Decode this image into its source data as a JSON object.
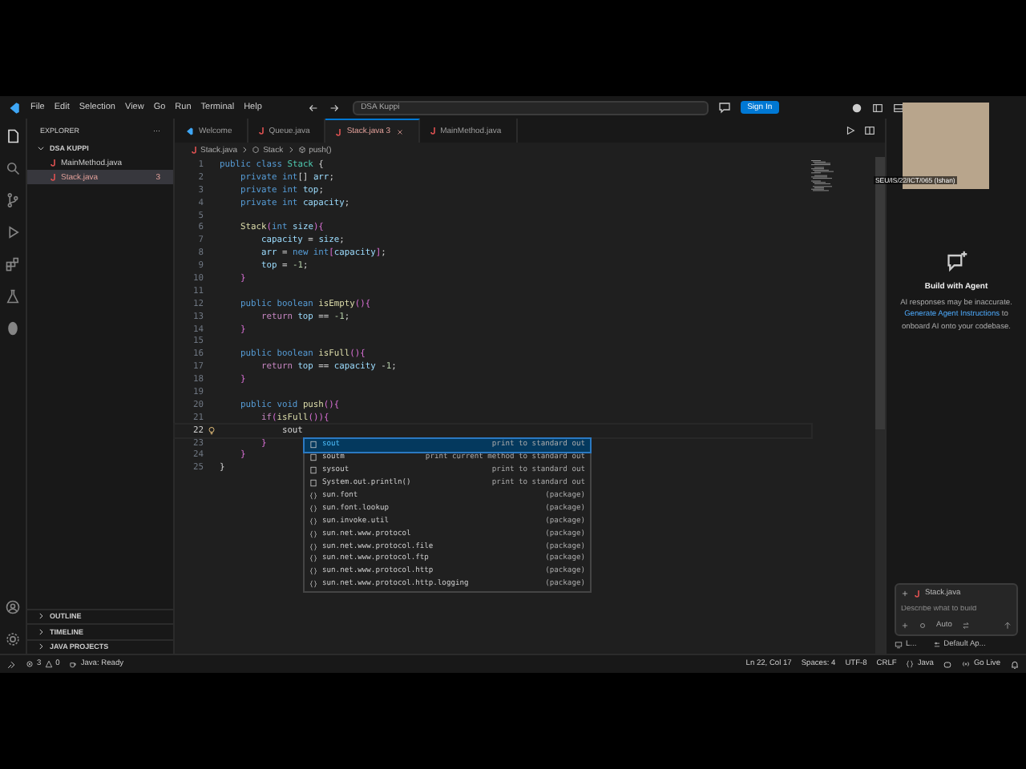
{
  "title_bar": {
    "menu": [
      "File",
      "Edit",
      "Selection",
      "View",
      "Go",
      "Run",
      "Terminal",
      "Help"
    ],
    "search": "DSA Kuppi",
    "sign_in": "Sign In"
  },
  "webcam": {
    "label": "SEU/IS/22/ICT/065 (Ishan)"
  },
  "sidebar": {
    "title": "EXPLORER",
    "more": "···",
    "folder": {
      "name": "DSA KUPPI",
      "expanded": true,
      "files": [
        {
          "name": "MainMethod.java",
          "selected": false
        },
        {
          "name": "Stack.java",
          "badge": "3",
          "selected": true
        }
      ]
    },
    "sections": [
      "OUTLINE",
      "TIMELINE",
      "JAVA PROJECTS"
    ]
  },
  "tabs": [
    {
      "label": "Welcome",
      "kind": "welcome",
      "selected": false
    },
    {
      "label": "Queue.java",
      "kind": "java",
      "selected": false
    },
    {
      "label": "Stack.java",
      "kind": "java",
      "badge": "3",
      "selected": true
    },
    {
      "label": "MainMethod.java",
      "kind": "java",
      "selected": false
    }
  ],
  "breadcrumb": [
    {
      "label": "Stack.java",
      "kind": "file"
    },
    {
      "label": "Stack",
      "kind": "class"
    },
    {
      "label": "push()",
      "kind": "method"
    }
  ],
  "code": [
    {
      "n": "1",
      "current": false,
      "tokens": [
        {
          "text": "public class ",
          "kind": "keyword"
        },
        {
          "text": "Stack",
          "kind": "type"
        },
        {
          "text": " {",
          "kind": "plain"
        }
      ]
    },
    {
      "n": "2",
      "current": false,
      "tokens": [
        {
          "text": "    private int",
          "kind": "keyword"
        },
        {
          "text": "[] ",
          "kind": "plain"
        },
        {
          "text": "arr",
          "kind": "variable"
        },
        {
          "text": ";",
          "kind": "plain"
        }
      ]
    },
    {
      "n": "3",
      "current": false,
      "tokens": [
        {
          "text": "    private int ",
          "kind": "keyword"
        },
        {
          "text": "top",
          "kind": "variable"
        },
        {
          "text": ";",
          "kind": "plain"
        }
      ]
    },
    {
      "n": "4",
      "current": false,
      "tokens": [
        {
          "text": "    private int ",
          "kind": "keyword"
        },
        {
          "text": "capacity",
          "kind": "variable"
        },
        {
          "text": ";",
          "kind": "plain"
        }
      ]
    },
    {
      "n": "5",
      "current": false
    },
    {
      "n": "6",
      "current": false,
      "tokens": [
        {
          "text": "    Stack",
          "kind": "function"
        },
        {
          "text": "(",
          "kind": "bracket"
        },
        {
          "text": "int ",
          "kind": "keyword"
        },
        {
          "text": "size",
          "kind": "variable"
        },
        {
          "text": "){",
          "kind": "bracket"
        }
      ]
    },
    {
      "n": "7",
      "current": false,
      "tokens": [
        {
          "text": "        capacity",
          "kind": "variable"
        },
        {
          "text": " = ",
          "kind": "plain"
        },
        {
          "text": "size",
          "kind": "variable"
        },
        {
          "text": ";",
          "kind": "plain"
        }
      ]
    },
    {
      "n": "8",
      "current": false,
      "tokens": [
        {
          "text": "        arr",
          "kind": "variable"
        },
        {
          "text": " = ",
          "kind": "plain"
        },
        {
          "text": "new int",
          "kind": "keyword"
        },
        {
          "text": "[",
          "kind": "bracket"
        },
        {
          "text": "capacity",
          "kind": "variable"
        },
        {
          "text": "]",
          "kind": "bracket"
        },
        {
          "text": ";",
          "kind": "plain"
        }
      ]
    },
    {
      "n": "9",
      "current": false,
      "tokens": [
        {
          "text": "        top",
          "kind": "variable"
        },
        {
          "text": " = ",
          "kind": "plain"
        },
        {
          "text": "-1",
          "kind": "number"
        },
        {
          "text": ";",
          "kind": "plain"
        }
      ]
    },
    {
      "n": "10",
      "current": false,
      "tokens": [
        {
          "text": "    }",
          "kind": "bracket"
        }
      ]
    },
    {
      "n": "11",
      "current": false
    },
    {
      "n": "12",
      "current": false,
      "tokens": [
        {
          "text": "    public boolean ",
          "kind": "keyword"
        },
        {
          "text": "isEmpty",
          "kind": "function"
        },
        {
          "text": "(){",
          "kind": "bracket"
        }
      ]
    },
    {
      "n": "13",
      "current": false,
      "tokens": [
        {
          "text": "        return ",
          "kind": "control"
        },
        {
          "text": "top",
          "kind": "variable"
        },
        {
          "text": " == ",
          "kind": "plain"
        },
        {
          "text": "-1",
          "kind": "number"
        },
        {
          "text": ";",
          "kind": "plain"
        }
      ]
    },
    {
      "n": "14",
      "current": false,
      "tokens": [
        {
          "text": "    }",
          "kind": "bracket"
        }
      ]
    },
    {
      "n": "15",
      "current": false
    },
    {
      "n": "16",
      "current": false,
      "tokens": [
        {
          "text": "    public boolean ",
          "kind": "keyword"
        },
        {
          "text": "isFull",
          "kind": "function"
        },
        {
          "text": "(){",
          "kind": "bracket"
        }
      ]
    },
    {
      "n": "17",
      "current": false,
      "tokens": [
        {
          "text": "        return ",
          "kind": "control"
        },
        {
          "text": "top",
          "kind": "variable"
        },
        {
          "text": " == ",
          "kind": "plain"
        },
        {
          "text": "capacity",
          "kind": "variable"
        },
        {
          "text": " -",
          "kind": "plain"
        },
        {
          "text": "1",
          "kind": "number"
        },
        {
          "text": ";",
          "kind": "plain"
        }
      ]
    },
    {
      "n": "18",
      "current": false,
      "tokens": [
        {
          "text": "    }",
          "kind": "bracket"
        }
      ]
    },
    {
      "n": "19",
      "current": false
    },
    {
      "n": "20",
      "current": false,
      "tokens": [
        {
          "text": "    public void ",
          "kind": "keyword"
        },
        {
          "text": "push",
          "kind": "function"
        },
        {
          "text": "(){",
          "kind": "bracket"
        }
      ]
    },
    {
      "n": "21",
      "current": false,
      "tokens": [
        {
          "text": "        if",
          "kind": "control"
        },
        {
          "text": "(",
          "kind": "bracket"
        },
        {
          "text": "isFull",
          "kind": "function"
        },
        {
          "text": "()){",
          "kind": "bracket"
        }
      ]
    },
    {
      "n": "22",
      "current": true,
      "tokens": [
        {
          "text": "            sout",
          "kind": "plain"
        }
      ]
    },
    {
      "n": "23",
      "current": false,
      "tokens": [
        {
          "text": "        }",
          "kind": "bracket"
        }
      ]
    },
    {
      "n": "24",
      "current": false,
      "tokens": [
        {
          "text": "    }",
          "kind": "bracket"
        }
      ]
    },
    {
      "n": "25",
      "current": false,
      "tokens": [
        {
          "text": "}",
          "kind": "plain"
        }
      ]
    }
  ],
  "suggestions": [
    {
      "kind": "snippet",
      "label": "sout",
      "detail": "print to standard out",
      "selected": true
    },
    {
      "kind": "snippet",
      "label": "soutm",
      "detail": "print current method to standard out",
      "selected": false
    },
    {
      "kind": "snippet",
      "label": "sysout",
      "detail": "print to standard out",
      "selected": false
    },
    {
      "kind": "snippet",
      "label": "System.out.println()",
      "detail": "print to standard out",
      "selected": false
    },
    {
      "kind": "module",
      "label": "sun.font",
      "detail": "(package)",
      "selected": false
    },
    {
      "kind": "module",
      "label": "sun.font.lookup",
      "detail": "(package)",
      "selected": false
    },
    {
      "kind": "module",
      "label": "sun.invoke.util",
      "detail": "(package)",
      "selected": false
    },
    {
      "kind": "module",
      "label": "sun.net.www.protocol",
      "detail": "(package)",
      "selected": false
    },
    {
      "kind": "module",
      "label": "sun.net.www.protocol.file",
      "detail": "(package)",
      "selected": false
    },
    {
      "kind": "module",
      "label": "sun.net.www.protocol.ftp",
      "detail": "(package)",
      "selected": false
    },
    {
      "kind": "module",
      "label": "sun.net.www.protocol.http",
      "detail": "(package)",
      "selected": false
    },
    {
      "kind": "module",
      "label": "sun.net.www.protocol.http.logging",
      "detail": "(package)",
      "selected": false
    }
  ],
  "chat": {
    "title": "Build with Agent",
    "note": "AI responses may be inaccurate.",
    "link": "Generate Agent Instructions",
    "note_end": "to onboard AI onto your codebase.",
    "attachment": "Stack.java",
    "placeholder": "Describe what to build",
    "mode": "Auto",
    "footer": [
      "L...",
      "Default Ap..."
    ]
  },
  "status_bar": {
    "errors": "3",
    "warnings": "0",
    "java_status": "Java: Ready",
    "right": [
      "Ln 22, Col 17",
      "Spaces: 4",
      "UTF-8",
      "CRLF",
      "Java",
      "Go Live"
    ]
  }
}
